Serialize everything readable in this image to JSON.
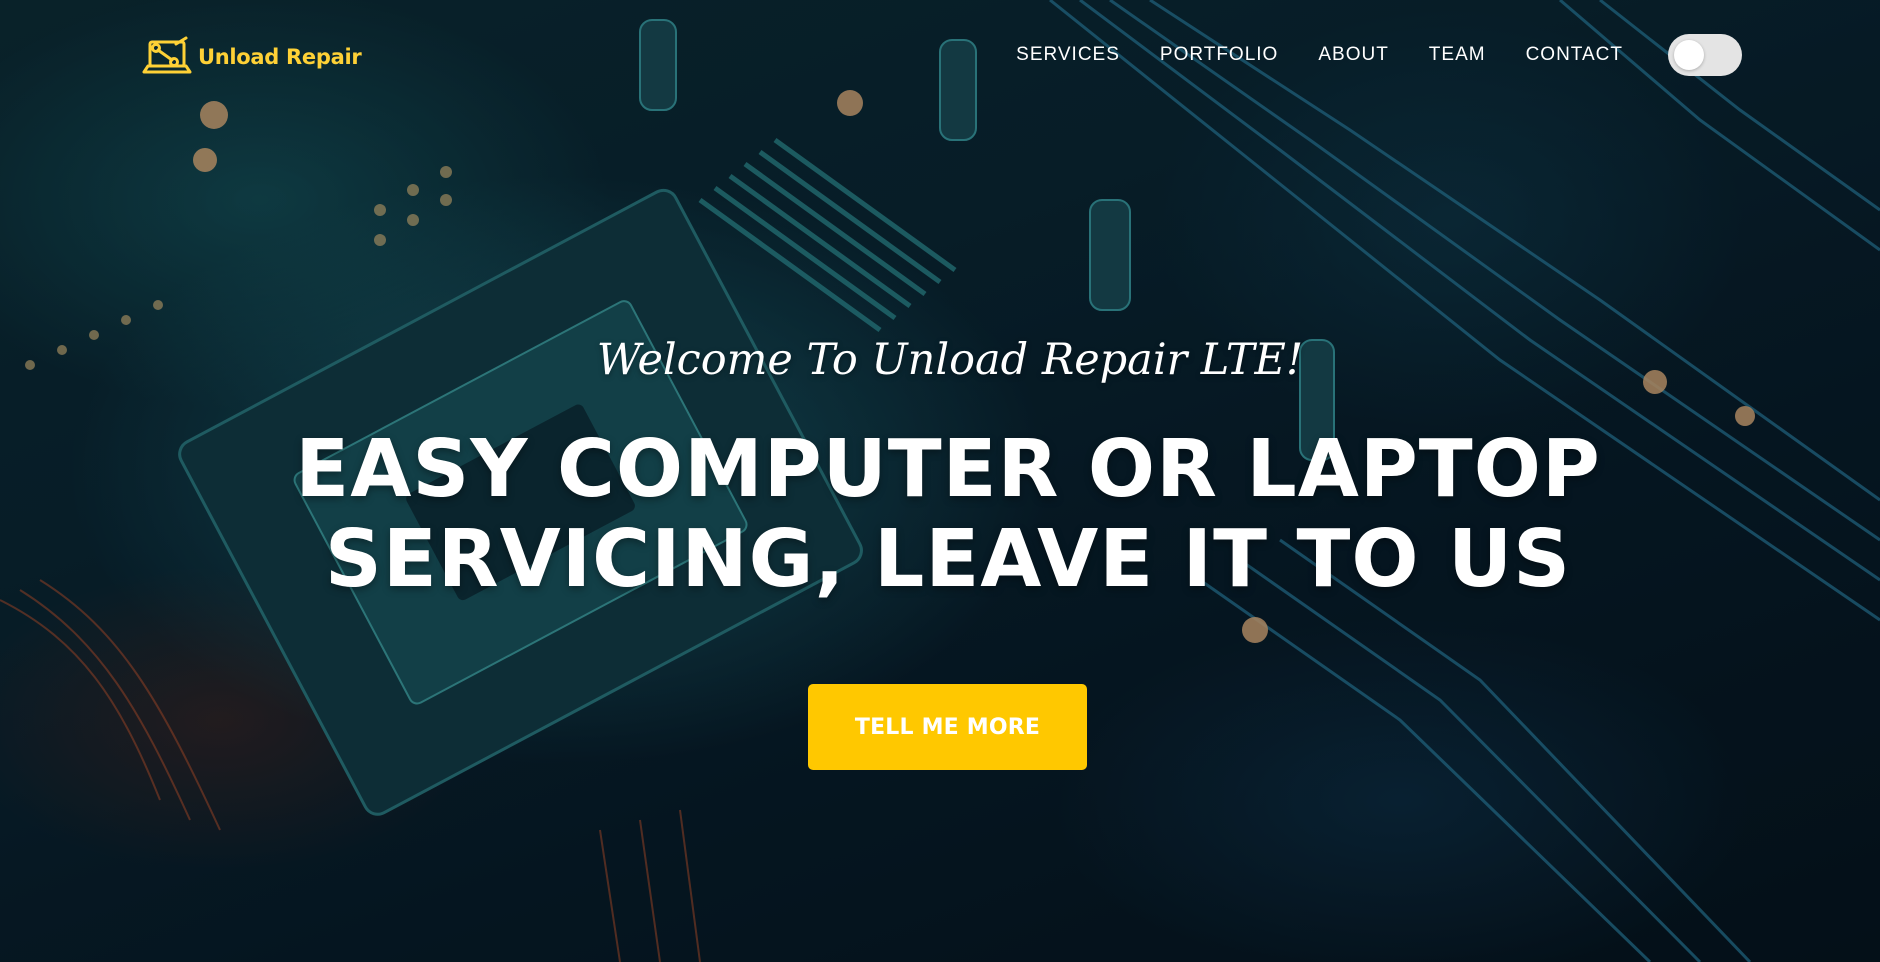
{
  "brand": {
    "name": "Unload Repair",
    "icon": "laptop-wrench-icon",
    "color": "#fed136"
  },
  "nav": {
    "items": [
      {
        "label": "SERVICES"
      },
      {
        "label": "PORTFOLIO"
      },
      {
        "label": "ABOUT"
      },
      {
        "label": "TEAM"
      },
      {
        "label": "CONTACT"
      }
    ],
    "theme_toggle": {
      "state": "off"
    }
  },
  "hero": {
    "subheading": "Welcome To Unload Repair LTE!",
    "heading_line1": "EASY COMPUTER OR LAPTOP",
    "heading_line2": "SERVICING, LEAVE IT TO US",
    "cta_label": "TELL ME MORE",
    "cta_color": "#ffc800",
    "background": "circuit-board-photo"
  }
}
